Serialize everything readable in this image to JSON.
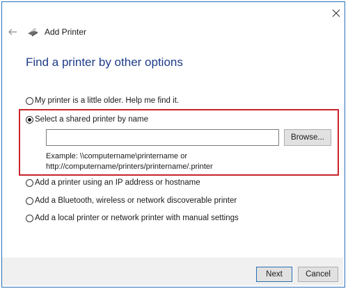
{
  "window": {
    "title": "Add Printer",
    "close_icon": "close-icon",
    "back_icon": "back-arrow-icon",
    "printer_icon": "printer-icon"
  },
  "page": {
    "heading": "Find a printer by other options"
  },
  "options": [
    {
      "label": "My printer is a little older. Help me find it.",
      "checked": false
    },
    {
      "label": "Select a shared printer by name",
      "checked": true
    },
    {
      "label": "Add a printer using an IP address or hostname",
      "checked": false
    },
    {
      "label": "Add a Bluetooth, wireless or network discoverable printer",
      "checked": false
    },
    {
      "label": "Add a local printer or network printer with manual settings",
      "checked": false
    }
  ],
  "shared_printer": {
    "input_value": "",
    "browse_label": "Browse...",
    "example_line1": "Example: \\\\computername\\printername or",
    "example_line2": "http://computername/printers/printername/.printer"
  },
  "footer": {
    "next_label": "Next",
    "cancel_label": "Cancel"
  },
  "colors": {
    "accent": "#2a6fb5",
    "heading": "#1e3b8a",
    "highlight": "#c8232c"
  }
}
